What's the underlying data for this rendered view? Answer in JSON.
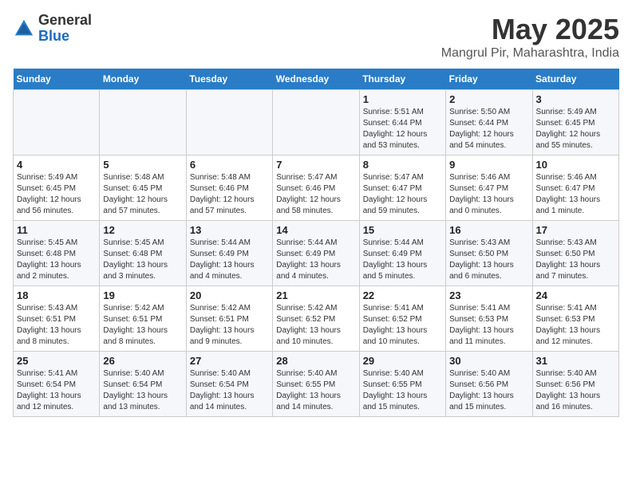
{
  "logo": {
    "general": "General",
    "blue": "Blue"
  },
  "title": "May 2025",
  "subtitle": "Mangrul Pir, Maharashtra, India",
  "days_of_week": [
    "Sunday",
    "Monday",
    "Tuesday",
    "Wednesday",
    "Thursday",
    "Friday",
    "Saturday"
  ],
  "weeks": [
    [
      {
        "day": "",
        "info": ""
      },
      {
        "day": "",
        "info": ""
      },
      {
        "day": "",
        "info": ""
      },
      {
        "day": "",
        "info": ""
      },
      {
        "day": "1",
        "info": "Sunrise: 5:51 AM\nSunset: 6:44 PM\nDaylight: 12 hours\nand 53 minutes."
      },
      {
        "day": "2",
        "info": "Sunrise: 5:50 AM\nSunset: 6:44 PM\nDaylight: 12 hours\nand 54 minutes."
      },
      {
        "day": "3",
        "info": "Sunrise: 5:49 AM\nSunset: 6:45 PM\nDaylight: 12 hours\nand 55 minutes."
      }
    ],
    [
      {
        "day": "4",
        "info": "Sunrise: 5:49 AM\nSunset: 6:45 PM\nDaylight: 12 hours\nand 56 minutes."
      },
      {
        "day": "5",
        "info": "Sunrise: 5:48 AM\nSunset: 6:45 PM\nDaylight: 12 hours\nand 57 minutes."
      },
      {
        "day": "6",
        "info": "Sunrise: 5:48 AM\nSunset: 6:46 PM\nDaylight: 12 hours\nand 57 minutes."
      },
      {
        "day": "7",
        "info": "Sunrise: 5:47 AM\nSunset: 6:46 PM\nDaylight: 12 hours\nand 58 minutes."
      },
      {
        "day": "8",
        "info": "Sunrise: 5:47 AM\nSunset: 6:47 PM\nDaylight: 12 hours\nand 59 minutes."
      },
      {
        "day": "9",
        "info": "Sunrise: 5:46 AM\nSunset: 6:47 PM\nDaylight: 13 hours\nand 0 minutes."
      },
      {
        "day": "10",
        "info": "Sunrise: 5:46 AM\nSunset: 6:47 PM\nDaylight: 13 hours\nand 1 minute."
      }
    ],
    [
      {
        "day": "11",
        "info": "Sunrise: 5:45 AM\nSunset: 6:48 PM\nDaylight: 13 hours\nand 2 minutes."
      },
      {
        "day": "12",
        "info": "Sunrise: 5:45 AM\nSunset: 6:48 PM\nDaylight: 13 hours\nand 3 minutes."
      },
      {
        "day": "13",
        "info": "Sunrise: 5:44 AM\nSunset: 6:49 PM\nDaylight: 13 hours\nand 4 minutes."
      },
      {
        "day": "14",
        "info": "Sunrise: 5:44 AM\nSunset: 6:49 PM\nDaylight: 13 hours\nand 4 minutes."
      },
      {
        "day": "15",
        "info": "Sunrise: 5:44 AM\nSunset: 6:49 PM\nDaylight: 13 hours\nand 5 minutes."
      },
      {
        "day": "16",
        "info": "Sunrise: 5:43 AM\nSunset: 6:50 PM\nDaylight: 13 hours\nand 6 minutes."
      },
      {
        "day": "17",
        "info": "Sunrise: 5:43 AM\nSunset: 6:50 PM\nDaylight: 13 hours\nand 7 minutes."
      }
    ],
    [
      {
        "day": "18",
        "info": "Sunrise: 5:43 AM\nSunset: 6:51 PM\nDaylight: 13 hours\nand 8 minutes."
      },
      {
        "day": "19",
        "info": "Sunrise: 5:42 AM\nSunset: 6:51 PM\nDaylight: 13 hours\nand 8 minutes."
      },
      {
        "day": "20",
        "info": "Sunrise: 5:42 AM\nSunset: 6:51 PM\nDaylight: 13 hours\nand 9 minutes."
      },
      {
        "day": "21",
        "info": "Sunrise: 5:42 AM\nSunset: 6:52 PM\nDaylight: 13 hours\nand 10 minutes."
      },
      {
        "day": "22",
        "info": "Sunrise: 5:41 AM\nSunset: 6:52 PM\nDaylight: 13 hours\nand 10 minutes."
      },
      {
        "day": "23",
        "info": "Sunrise: 5:41 AM\nSunset: 6:53 PM\nDaylight: 13 hours\nand 11 minutes."
      },
      {
        "day": "24",
        "info": "Sunrise: 5:41 AM\nSunset: 6:53 PM\nDaylight: 13 hours\nand 12 minutes."
      }
    ],
    [
      {
        "day": "25",
        "info": "Sunrise: 5:41 AM\nSunset: 6:54 PM\nDaylight: 13 hours\nand 12 minutes."
      },
      {
        "day": "26",
        "info": "Sunrise: 5:40 AM\nSunset: 6:54 PM\nDaylight: 13 hours\nand 13 minutes."
      },
      {
        "day": "27",
        "info": "Sunrise: 5:40 AM\nSunset: 6:54 PM\nDaylight: 13 hours\nand 14 minutes."
      },
      {
        "day": "28",
        "info": "Sunrise: 5:40 AM\nSunset: 6:55 PM\nDaylight: 13 hours\nand 14 minutes."
      },
      {
        "day": "29",
        "info": "Sunrise: 5:40 AM\nSunset: 6:55 PM\nDaylight: 13 hours\nand 15 minutes."
      },
      {
        "day": "30",
        "info": "Sunrise: 5:40 AM\nSunset: 6:56 PM\nDaylight: 13 hours\nand 15 minutes."
      },
      {
        "day": "31",
        "info": "Sunrise: 5:40 AM\nSunset: 6:56 PM\nDaylight: 13 hours\nand 16 minutes."
      }
    ]
  ]
}
